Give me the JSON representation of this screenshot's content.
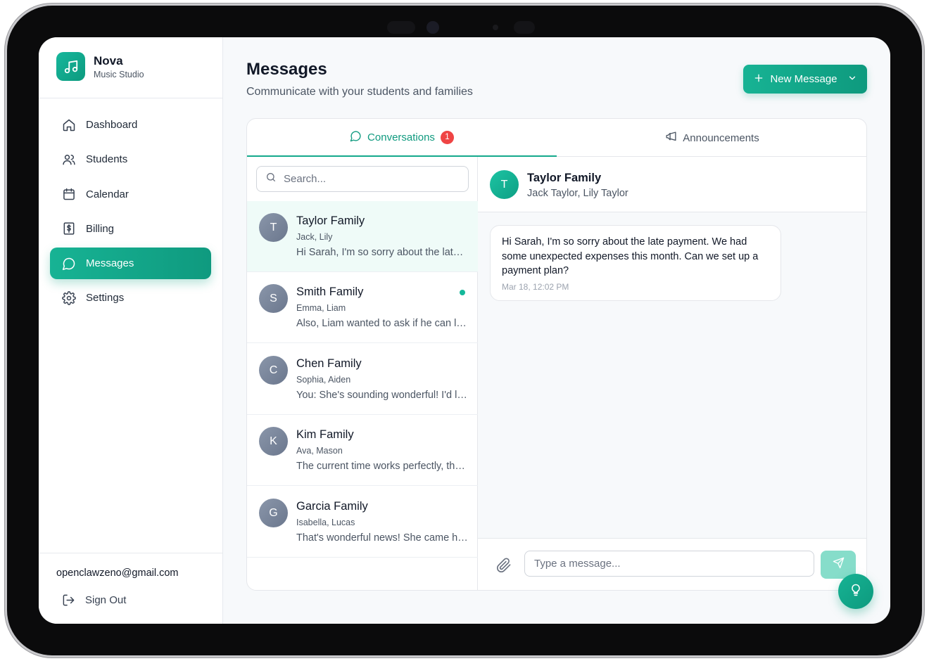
{
  "brand": {
    "name": "Nova",
    "subtitle": "Music Studio",
    "icon": "music-note-icon"
  },
  "sidebar": {
    "items": [
      {
        "label": "Dashboard",
        "icon": "home-icon",
        "active": false
      },
      {
        "label": "Students",
        "icon": "users-icon",
        "active": false
      },
      {
        "label": "Calendar",
        "icon": "calendar-icon",
        "active": false
      },
      {
        "label": "Billing",
        "icon": "billing-icon",
        "active": false
      },
      {
        "label": "Messages",
        "icon": "message-icon",
        "active": true
      },
      {
        "label": "Settings",
        "icon": "gear-icon",
        "active": false
      }
    ],
    "user_email": "openclawzeno@gmail.com",
    "sign_out_label": "Sign Out"
  },
  "header": {
    "title": "Messages",
    "subtitle": "Communicate with your students and families",
    "new_message_label": "New Message"
  },
  "tabs": [
    {
      "label": "Conversations",
      "badge": "1",
      "active": true
    },
    {
      "label": "Announcements",
      "active": false
    }
  ],
  "search": {
    "placeholder": "Search..."
  },
  "conversations": [
    {
      "initial": "T",
      "name": "Taylor Family",
      "members": "Jack, Lily",
      "preview": "Hi Sarah, I'm so sorry about the late payment. We had some unexpected expenses this month.",
      "selected": true,
      "unread": false
    },
    {
      "initial": "S",
      "name": "Smith Family",
      "members": "Emma, Liam",
      "preview": "Also, Liam wanted to ask if he can learn a new song next week.",
      "selected": false,
      "unread": true
    },
    {
      "initial": "C",
      "name": "Chen Family",
      "members": "Sophia, Aiden",
      "preview": "You: She's sounding wonderful! I'd love to hear more next week.",
      "selected": false,
      "unread": false
    },
    {
      "initial": "K",
      "name": "Kim Family",
      "members": "Ava, Mason",
      "preview": "The current time works perfectly, thank you so much!",
      "selected": false,
      "unread": false
    },
    {
      "initial": "G",
      "name": "Garcia Family",
      "members": "Isabella, Lucas",
      "preview": "That's wonderful news! She came home so excited.",
      "selected": false,
      "unread": false
    }
  ],
  "chat": {
    "initial": "T",
    "name": "Taylor Family",
    "members": "Jack Taylor, Lily Taylor",
    "messages": [
      {
        "text": "Hi Sarah, I'm so sorry about the late payment. We had some unexpected expenses this month. Can we set up a payment plan?",
        "time": "Mar 18, 12:02 PM"
      }
    ],
    "input_placeholder": "Type a message..."
  },
  "colors": {
    "accent": "#14a98c",
    "badge": "#ef4444",
    "send_disabled": "#86ddca"
  }
}
